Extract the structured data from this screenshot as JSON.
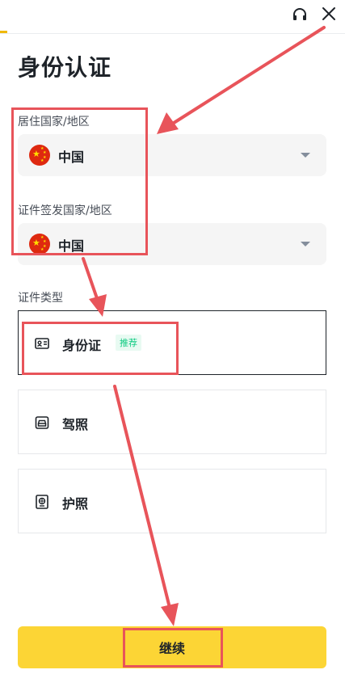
{
  "header": {
    "close_icon": "close-icon",
    "support_icon": "headset-icon"
  },
  "page": {
    "title": "身份认证"
  },
  "residence": {
    "label": "居住国家/地区",
    "value": "中国",
    "flag": "china-flag-icon"
  },
  "issuing": {
    "label": "证件签发国家/地区",
    "value": "中国",
    "flag": "china-flag-icon"
  },
  "doc_type": {
    "label": "证件类型",
    "options": [
      {
        "label": "身份证",
        "badge": "推荐",
        "icon": "id-card-icon",
        "selected": true
      },
      {
        "label": "驾照",
        "icon": "drivers-license-icon",
        "selected": false
      },
      {
        "label": "护照",
        "icon": "passport-icon",
        "selected": false
      }
    ]
  },
  "actions": {
    "continue_label": "继续"
  },
  "colors": {
    "accent": "#fcd535",
    "annotation": "#e8545a",
    "badge_green": "#0ecb81"
  }
}
